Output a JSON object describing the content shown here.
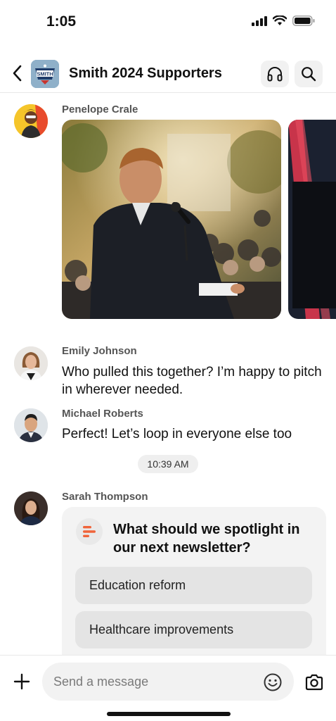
{
  "status_bar": {
    "time": "1:05"
  },
  "header": {
    "title": "Smith 2024 Supporters",
    "avatar_text": "SMITH"
  },
  "messages": [
    {
      "sender": "Penelope Crale"
    },
    {
      "sender": "Emily Johnson",
      "text": "Who pulled this together? I’m happy to pitch in wherever needed."
    },
    {
      "sender": "Michael Roberts",
      "text": "Perfect! Let’s loop in everyone else too"
    },
    {
      "sender": "Sarah Thompson"
    }
  ],
  "timestamp": "10:39 AM",
  "poll": {
    "question": "What should we spotlight in our next newsletter?",
    "options": [
      "Education reform",
      "Healthcare improvements"
    ]
  },
  "composer": {
    "placeholder": "Send a message"
  },
  "colors": {
    "accent": "#f0643a",
    "chip": "#efefef",
    "card": "#f3f3f3"
  }
}
